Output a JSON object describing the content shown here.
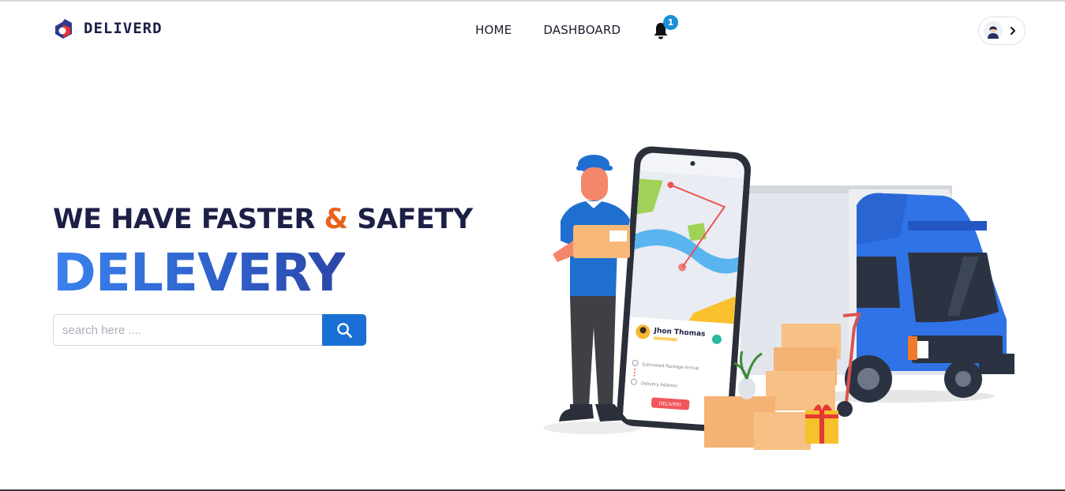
{
  "brand": {
    "name": "DELIVERD"
  },
  "nav": {
    "items": [
      {
        "label": "HOME"
      },
      {
        "label": "DASHBOARD"
      }
    ]
  },
  "notifications": {
    "count": "1"
  },
  "hero": {
    "tagline_part1": "WE HAVE FASTER",
    "tagline_amp": "&",
    "tagline_part2": "SAFETY",
    "headline": "DELEVERY"
  },
  "search": {
    "placeholder": "search here ....",
    "value": ""
  },
  "illustration": {
    "courier_name": "Jhon Thomas",
    "row1_text": "Estimated Package Arrival",
    "row2_text": "Delivery Address",
    "button_label": "DELIVERY"
  },
  "colors": {
    "brand_dark": "#1d2046",
    "accent_orange": "#e8621c",
    "primary_blue": "#1a6fd4",
    "badge_blue": "#1a8fd6"
  },
  "icons": [
    "logo-icon",
    "bell-icon",
    "search-icon",
    "avatar-icon",
    "chevron-right-icon"
  ]
}
